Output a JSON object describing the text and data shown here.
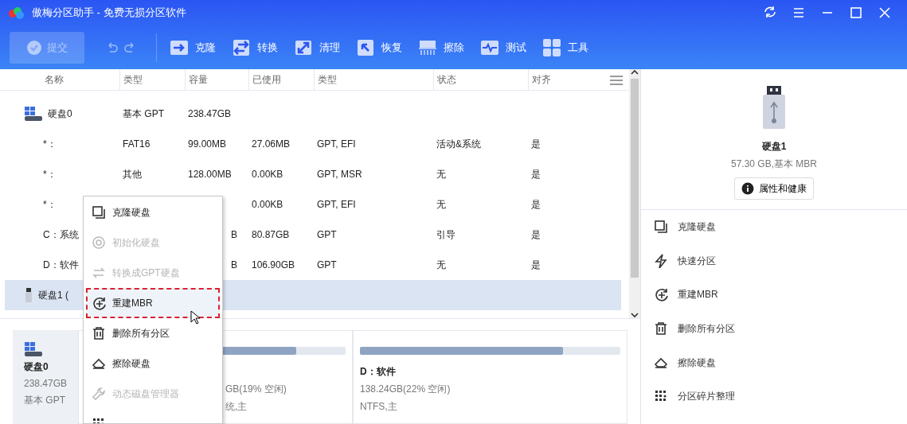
{
  "window": {
    "title": "傲梅分区助手 - 免费无损分区软件"
  },
  "toolbar": {
    "commit": {
      "label": "提交",
      "disabled": true
    },
    "items": [
      {
        "label": "克隆",
        "kind": "clone"
      },
      {
        "label": "转换",
        "kind": "convert"
      },
      {
        "label": "清理",
        "kind": "clean"
      },
      {
        "label": "恢复",
        "kind": "recover"
      },
      {
        "label": "擦除",
        "kind": "wipe"
      },
      {
        "label": "测试",
        "kind": "test"
      },
      {
        "label": "工具",
        "kind": "tools"
      }
    ]
  },
  "table": {
    "columns": [
      "名称",
      "类型",
      "容量",
      "已使用",
      "类型",
      "状态",
      "对齐"
    ],
    "rows": [
      {
        "kind": "disk",
        "selected": false,
        "name": "硬盘0",
        "type": "基本 GPT",
        "capacity": "238.47GB"
      },
      {
        "kind": "partition",
        "selected": false,
        "name": "*：",
        "type": "FAT16",
        "capacity": "99.00MB",
        "used": "27.06MB",
        "fs": "GPT, EFI",
        "status": "活动&系统",
        "align": "是"
      },
      {
        "kind": "partition",
        "selected": false,
        "name": "*：",
        "type": "其他",
        "capacity": "128.00MB",
        "used": "0.00KB",
        "fs": "GPT, MSR",
        "status": "无",
        "align": "是"
      },
      {
        "kind": "partition",
        "selected": false,
        "name": "*：",
        "used": "0.00KB",
        "fs": "GPT, EFI",
        "status": "无",
        "align": "是"
      },
      {
        "kind": "partition",
        "selected": false,
        "name": "C：系统",
        "capacity_tail": "B",
        "used": "80.87GB",
        "fs": "GPT",
        "status": "引导",
        "align": "是"
      },
      {
        "kind": "partition",
        "selected": false,
        "name": "D：软件",
        "capacity_tail": "B",
        "used": "106.90GB",
        "fs": "GPT",
        "status": "无",
        "align": "是"
      },
      {
        "kind": "usb",
        "selected": true,
        "name": "硬盘1 ("
      }
    ]
  },
  "context_menu": [
    {
      "label": "克隆硬盘",
      "kind": "clone",
      "disabled": false,
      "selected": false
    },
    {
      "label": "初始化硬盘",
      "kind": "init",
      "disabled": true,
      "selected": false
    },
    {
      "label": "转换成GPT硬盘",
      "kind": "convert",
      "disabled": true,
      "selected": false
    },
    {
      "label": "重建MBR",
      "kind": "rebuild",
      "disabled": false,
      "selected": true
    },
    {
      "label": "删除所有分区",
      "kind": "delete",
      "disabled": false,
      "selected": false
    },
    {
      "label": "擦除硬盘",
      "kind": "erase",
      "disabled": false,
      "selected": false
    },
    {
      "label": "动态磁盘管理器",
      "kind": "dynamic",
      "disabled": true,
      "selected": false
    },
    {
      "kind": "defrag"
    }
  ],
  "disk_map": [
    {
      "kind": "disk",
      "name": "硬盘0",
      "lines": [
        "238.47GB",
        "基本 GPT"
      ]
    },
    {
      "kind": "partition",
      "level": 0.81,
      "lines": [
        "GB(19% 空闲)",
        "统,主"
      ]
    },
    {
      "kind": "partition",
      "name": "D：软件",
      "level": 0.78,
      "lines": [
        "138.24GB(22% 空闲)",
        "NTFS,主"
      ]
    }
  ],
  "details": {
    "name": "硬盘1",
    "info": "57.30 GB,基本 MBR",
    "button": "属性和健康",
    "actions": [
      {
        "label": "克隆硬盘",
        "kind": "clone"
      },
      {
        "label": "快速分区",
        "kind": "quick"
      },
      {
        "label": "重建MBR",
        "kind": "rebuild"
      },
      {
        "label": "删除所有分区",
        "kind": "delete"
      },
      {
        "label": "擦除硬盘",
        "kind": "erase"
      },
      {
        "label": "分区碎片整理",
        "kind": "defrag"
      }
    ]
  }
}
